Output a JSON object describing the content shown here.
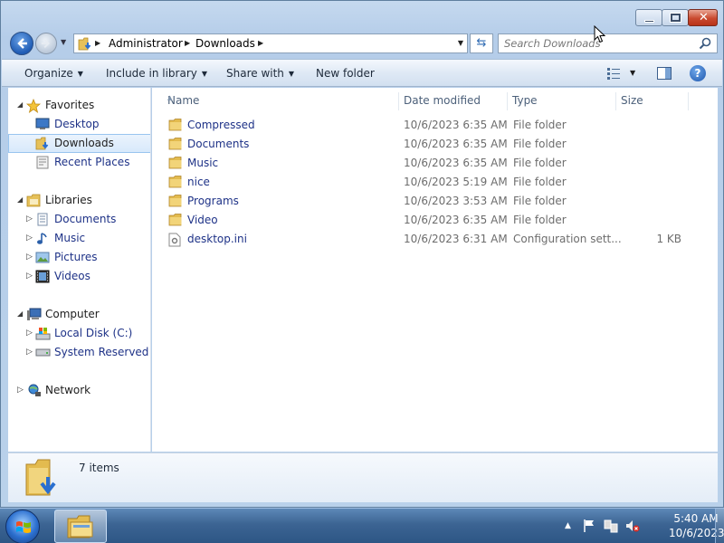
{
  "window": {
    "minimize_icon": "minimize-icon",
    "maximize_icon": "maximize-icon",
    "close_glyph": "✕"
  },
  "address": {
    "crumbs": [
      "Administrator",
      "Downloads"
    ],
    "search_placeholder": "Search Downloads"
  },
  "toolbar": {
    "organize": "Organize",
    "include_in_library": "Include in library",
    "share_with": "Share with",
    "new_folder": "New folder",
    "help": "?"
  },
  "nav": {
    "favorites": "Favorites",
    "desktop": "Desktop",
    "downloads": "Downloads",
    "recent_places": "Recent Places",
    "libraries": "Libraries",
    "documents": "Documents",
    "music": "Music",
    "pictures": "Pictures",
    "videos": "Videos",
    "computer": "Computer",
    "local_disk": "Local Disk (C:)",
    "system_reserved": "System Reserved (E:)",
    "network": "Network"
  },
  "columns": {
    "name": "Name",
    "date_modified": "Date modified",
    "type": "Type",
    "size": "Size"
  },
  "files": [
    {
      "name": "Compressed",
      "date": "10/6/2023 6:35 AM",
      "type": "File folder",
      "size": ""
    },
    {
      "name": "Documents",
      "date": "10/6/2023 6:35 AM",
      "type": "File folder",
      "size": ""
    },
    {
      "name": "Music",
      "date": "10/6/2023 6:35 AM",
      "type": "File folder",
      "size": ""
    },
    {
      "name": "nice",
      "date": "10/6/2023 5:19 AM",
      "type": "File folder",
      "size": ""
    },
    {
      "name": "Programs",
      "date": "10/6/2023 3:53 AM",
      "type": "File folder",
      "size": ""
    },
    {
      "name": "Video",
      "date": "10/6/2023 6:35 AM",
      "type": "File folder",
      "size": ""
    },
    {
      "name": "desktop.ini",
      "date": "10/6/2023 6:31 AM",
      "type": "Configuration sett...",
      "size": "1 KB"
    }
  ],
  "details": {
    "count": "7 items"
  },
  "taskbar": {
    "time": "5:40 AM",
    "date": "10/6/2023"
  },
  "colors": {
    "link_blue": "#1e3287",
    "selection_border": "#99c5ef",
    "taskbar_blue": "#3c6493"
  }
}
